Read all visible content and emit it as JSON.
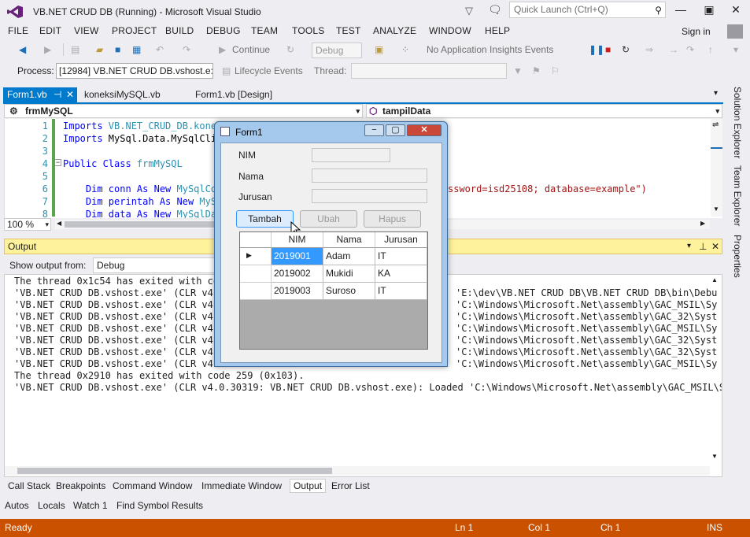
{
  "app": {
    "title": "VB.NET CRUD DB (Running) - Microsoft Visual Studio",
    "quick_launch_placeholder": "Quick Launch (Ctrl+Q)",
    "sign_in": "Sign in"
  },
  "menu": [
    "FILE",
    "EDIT",
    "VIEW",
    "PROJECT",
    "BUILD",
    "DEBUG",
    "TEAM",
    "TOOLS",
    "TEST",
    "ANALYZE",
    "WINDOW",
    "HELP"
  ],
  "toolbar": {
    "continue": "Continue",
    "config": "Debug",
    "ai_events": "No Application Insights Events",
    "process_label": "Process:",
    "process_value": "[12984] VB.NET CRUD DB.vshost.e:",
    "lifecycle": "Lifecycle Events",
    "thread_label": "Thread:"
  },
  "tabs": {
    "tab1": "Form1.vb",
    "tab2": "koneksiMySQL.vb",
    "tab3": "Form1.vb [Design]",
    "nav_left": "frmMySQL",
    "nav_right": "tampilData"
  },
  "editor": {
    "zoom": "100 %",
    "lines": [
      {
        "no": "1",
        "pre": "Imports ",
        "rest": "VB.NET_CRUD_DB.kone"
      },
      {
        "no": "2",
        "pre": "Imports ",
        "rest": "MySql.Data.MySqlCli"
      },
      {
        "no": "3",
        "pre": "",
        "rest": ""
      },
      {
        "no": "4",
        "pre": "Public Class ",
        "rest": "frmMySQL"
      },
      {
        "no": "5",
        "pre": "",
        "rest": ""
      },
      {
        "no": "6",
        "pre": "    Dim conn As New ",
        "rest": "MySqlCon"
      },
      {
        "no": "7",
        "pre": "    Dim perintah As New ",
        "rest": "MyS"
      },
      {
        "no": "8",
        "pre": "    Dim data As New ",
        "rest": "MySqlDat"
      }
    ],
    "line6_tail": "ssword=isd25108; database=example\")"
  },
  "output": {
    "title": "Output",
    "show_from_label": "Show output from:",
    "show_from_value": "Debug",
    "lines": [
      {
        "left": "The thread 0x1c54 has exited with co",
        "right": ""
      },
      {
        "left": "'VB.NET CRUD DB.vshost.exe' (CLR v4.",
        "right": "'E:\\dev\\VB.NET CRUD DB\\VB.NET CRUD DB\\bin\\Debu"
      },
      {
        "left": "'VB.NET CRUD DB.vshost.exe' (CLR v4.",
        "right": "'C:\\Windows\\Microsoft.Net\\assembly\\GAC_MSIL\\Sy"
      },
      {
        "left": "'VB.NET CRUD DB.vshost.exe' (CLR v4.",
        "right": "'C:\\Windows\\Microsoft.Net\\assembly\\GAC_32\\Syst"
      },
      {
        "left": "'VB.NET CRUD DB.vshost.exe' (CLR v4.",
        "right": "'C:\\Windows\\Microsoft.Net\\assembly\\GAC_MSIL\\Sy"
      },
      {
        "left": "'VB.NET CRUD DB.vshost.exe' (CLR v4.",
        "right": "'C:\\Windows\\Microsoft.Net\\assembly\\GAC_32\\Syst"
      },
      {
        "left": "'VB.NET CRUD DB.vshost.exe' (CLR v4.",
        "right": "'C:\\Windows\\Microsoft.Net\\assembly\\GAC_32\\Syst"
      },
      {
        "left": "'VB.NET CRUD DB.vshost.exe' (CLR v4.",
        "right": "'C:\\Windows\\Microsoft.Net\\assembly\\GAC_MSIL\\Sy"
      }
    ],
    "full_line1": "The thread 0x2910 has exited with code 259 (0x103).",
    "full_line2": "'VB.NET CRUD DB.vshost.exe' (CLR v4.0.30319: VB.NET CRUD DB.vshost.exe): Loaded 'C:\\Windows\\Microsoft.Net\\assembly\\GAC_MSIL\\Sy"
  },
  "bottom_tabs": [
    "Call Stack",
    "Breakpoints",
    "Command Window",
    "Immediate Window",
    "Output",
    "Error List"
  ],
  "bottom_tabs2": [
    "Autos",
    "Locals",
    "Watch 1",
    "Find Symbol Results"
  ],
  "side_tabs": [
    "Solution Explorer",
    "Team Explorer",
    "Properties"
  ],
  "status": {
    "ready": "Ready",
    "ln": "Ln 1",
    "col": "Col 1",
    "ch": "Ch 1",
    "ins": "INS"
  },
  "form1": {
    "title": "Form1",
    "labels": {
      "nim": "NIM",
      "nama": "Nama",
      "jurusan": "Jurusan"
    },
    "buttons": {
      "tambah": "Tambah",
      "ubah": "Ubah",
      "hapus": "Hapus"
    },
    "grid": {
      "columns": [
        "NIM",
        "Nama",
        "Jurusan"
      ],
      "rows": [
        [
          "2019001",
          "Adam",
          "IT"
        ],
        [
          "2019002",
          "Mukidi",
          "KA"
        ],
        [
          "2019003",
          "Suroso",
          "IT"
        ]
      ]
    }
  }
}
